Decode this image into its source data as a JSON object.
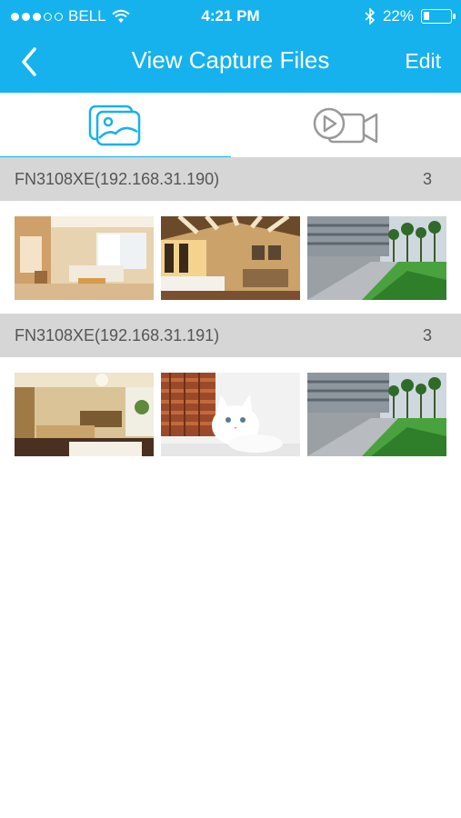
{
  "status_bar": {
    "carrier": "BELL",
    "time": "4:21 PM",
    "battery_text": "22%",
    "battery_level": 0.22
  },
  "nav": {
    "title": "View Capture Files",
    "edit_label": "Edit"
  },
  "tabs": [
    {
      "icon": "image-gallery-icon",
      "selected": true
    },
    {
      "icon": "video-camera-icon",
      "selected": false
    }
  ],
  "groups": [
    {
      "device": "FN3108XE(192.168.31.190)",
      "count": "3",
      "thumbnails": [
        "living-room-photo",
        "bedroom-photo",
        "office-campus-photo"
      ]
    },
    {
      "device": "FN3108XE(192.168.31.191)",
      "count": "3",
      "thumbnails": [
        "living-room-photo-2",
        "white-kitten-photo",
        "office-campus-photo-2"
      ]
    }
  ],
  "colors": {
    "accent": "#15b2ee",
    "group_header_bg": "#d6d6d6"
  }
}
